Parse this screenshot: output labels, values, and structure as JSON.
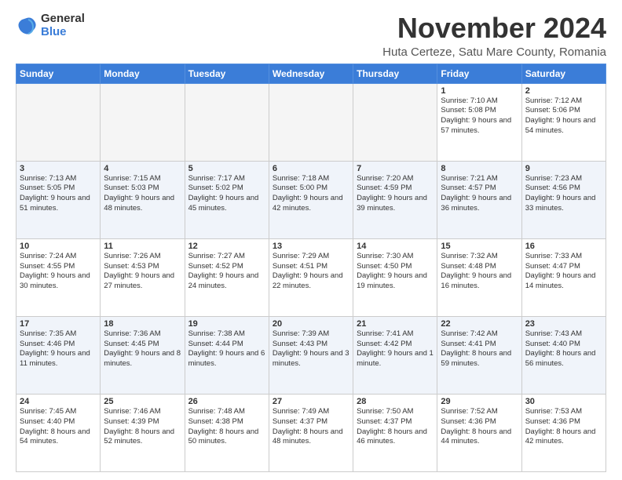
{
  "logo": {
    "general": "General",
    "blue": "Blue"
  },
  "header": {
    "title": "November 2024",
    "subtitle": "Huta Certeze, Satu Mare County, Romania"
  },
  "weekdays": [
    "Sunday",
    "Monday",
    "Tuesday",
    "Wednesday",
    "Thursday",
    "Friday",
    "Saturday"
  ],
  "weeks": [
    [
      {
        "day": "",
        "info": ""
      },
      {
        "day": "",
        "info": ""
      },
      {
        "day": "",
        "info": ""
      },
      {
        "day": "",
        "info": ""
      },
      {
        "day": "",
        "info": ""
      },
      {
        "day": "1",
        "info": "Sunrise: 7:10 AM\nSunset: 5:08 PM\nDaylight: 9 hours and 57 minutes."
      },
      {
        "day": "2",
        "info": "Sunrise: 7:12 AM\nSunset: 5:06 PM\nDaylight: 9 hours and 54 minutes."
      }
    ],
    [
      {
        "day": "3",
        "info": "Sunrise: 7:13 AM\nSunset: 5:05 PM\nDaylight: 9 hours and 51 minutes."
      },
      {
        "day": "4",
        "info": "Sunrise: 7:15 AM\nSunset: 5:03 PM\nDaylight: 9 hours and 48 minutes."
      },
      {
        "day": "5",
        "info": "Sunrise: 7:17 AM\nSunset: 5:02 PM\nDaylight: 9 hours and 45 minutes."
      },
      {
        "day": "6",
        "info": "Sunrise: 7:18 AM\nSunset: 5:00 PM\nDaylight: 9 hours and 42 minutes."
      },
      {
        "day": "7",
        "info": "Sunrise: 7:20 AM\nSunset: 4:59 PM\nDaylight: 9 hours and 39 minutes."
      },
      {
        "day": "8",
        "info": "Sunrise: 7:21 AM\nSunset: 4:57 PM\nDaylight: 9 hours and 36 minutes."
      },
      {
        "day": "9",
        "info": "Sunrise: 7:23 AM\nSunset: 4:56 PM\nDaylight: 9 hours and 33 minutes."
      }
    ],
    [
      {
        "day": "10",
        "info": "Sunrise: 7:24 AM\nSunset: 4:55 PM\nDaylight: 9 hours and 30 minutes."
      },
      {
        "day": "11",
        "info": "Sunrise: 7:26 AM\nSunset: 4:53 PM\nDaylight: 9 hours and 27 minutes."
      },
      {
        "day": "12",
        "info": "Sunrise: 7:27 AM\nSunset: 4:52 PM\nDaylight: 9 hours and 24 minutes."
      },
      {
        "day": "13",
        "info": "Sunrise: 7:29 AM\nSunset: 4:51 PM\nDaylight: 9 hours and 22 minutes."
      },
      {
        "day": "14",
        "info": "Sunrise: 7:30 AM\nSunset: 4:50 PM\nDaylight: 9 hours and 19 minutes."
      },
      {
        "day": "15",
        "info": "Sunrise: 7:32 AM\nSunset: 4:48 PM\nDaylight: 9 hours and 16 minutes."
      },
      {
        "day": "16",
        "info": "Sunrise: 7:33 AM\nSunset: 4:47 PM\nDaylight: 9 hours and 14 minutes."
      }
    ],
    [
      {
        "day": "17",
        "info": "Sunrise: 7:35 AM\nSunset: 4:46 PM\nDaylight: 9 hours and 11 minutes."
      },
      {
        "day": "18",
        "info": "Sunrise: 7:36 AM\nSunset: 4:45 PM\nDaylight: 9 hours and 8 minutes."
      },
      {
        "day": "19",
        "info": "Sunrise: 7:38 AM\nSunset: 4:44 PM\nDaylight: 9 hours and 6 minutes."
      },
      {
        "day": "20",
        "info": "Sunrise: 7:39 AM\nSunset: 4:43 PM\nDaylight: 9 hours and 3 minutes."
      },
      {
        "day": "21",
        "info": "Sunrise: 7:41 AM\nSunset: 4:42 PM\nDaylight: 9 hours and 1 minute."
      },
      {
        "day": "22",
        "info": "Sunrise: 7:42 AM\nSunset: 4:41 PM\nDaylight: 8 hours and 59 minutes."
      },
      {
        "day": "23",
        "info": "Sunrise: 7:43 AM\nSunset: 4:40 PM\nDaylight: 8 hours and 56 minutes."
      }
    ],
    [
      {
        "day": "24",
        "info": "Sunrise: 7:45 AM\nSunset: 4:40 PM\nDaylight: 8 hours and 54 minutes."
      },
      {
        "day": "25",
        "info": "Sunrise: 7:46 AM\nSunset: 4:39 PM\nDaylight: 8 hours and 52 minutes."
      },
      {
        "day": "26",
        "info": "Sunrise: 7:48 AM\nSunset: 4:38 PM\nDaylight: 8 hours and 50 minutes."
      },
      {
        "day": "27",
        "info": "Sunrise: 7:49 AM\nSunset: 4:37 PM\nDaylight: 8 hours and 48 minutes."
      },
      {
        "day": "28",
        "info": "Sunrise: 7:50 AM\nSunset: 4:37 PM\nDaylight: 8 hours and 46 minutes."
      },
      {
        "day": "29",
        "info": "Sunrise: 7:52 AM\nSunset: 4:36 PM\nDaylight: 8 hours and 44 minutes."
      },
      {
        "day": "30",
        "info": "Sunrise: 7:53 AM\nSunset: 4:36 PM\nDaylight: 8 hours and 42 minutes."
      }
    ]
  ]
}
